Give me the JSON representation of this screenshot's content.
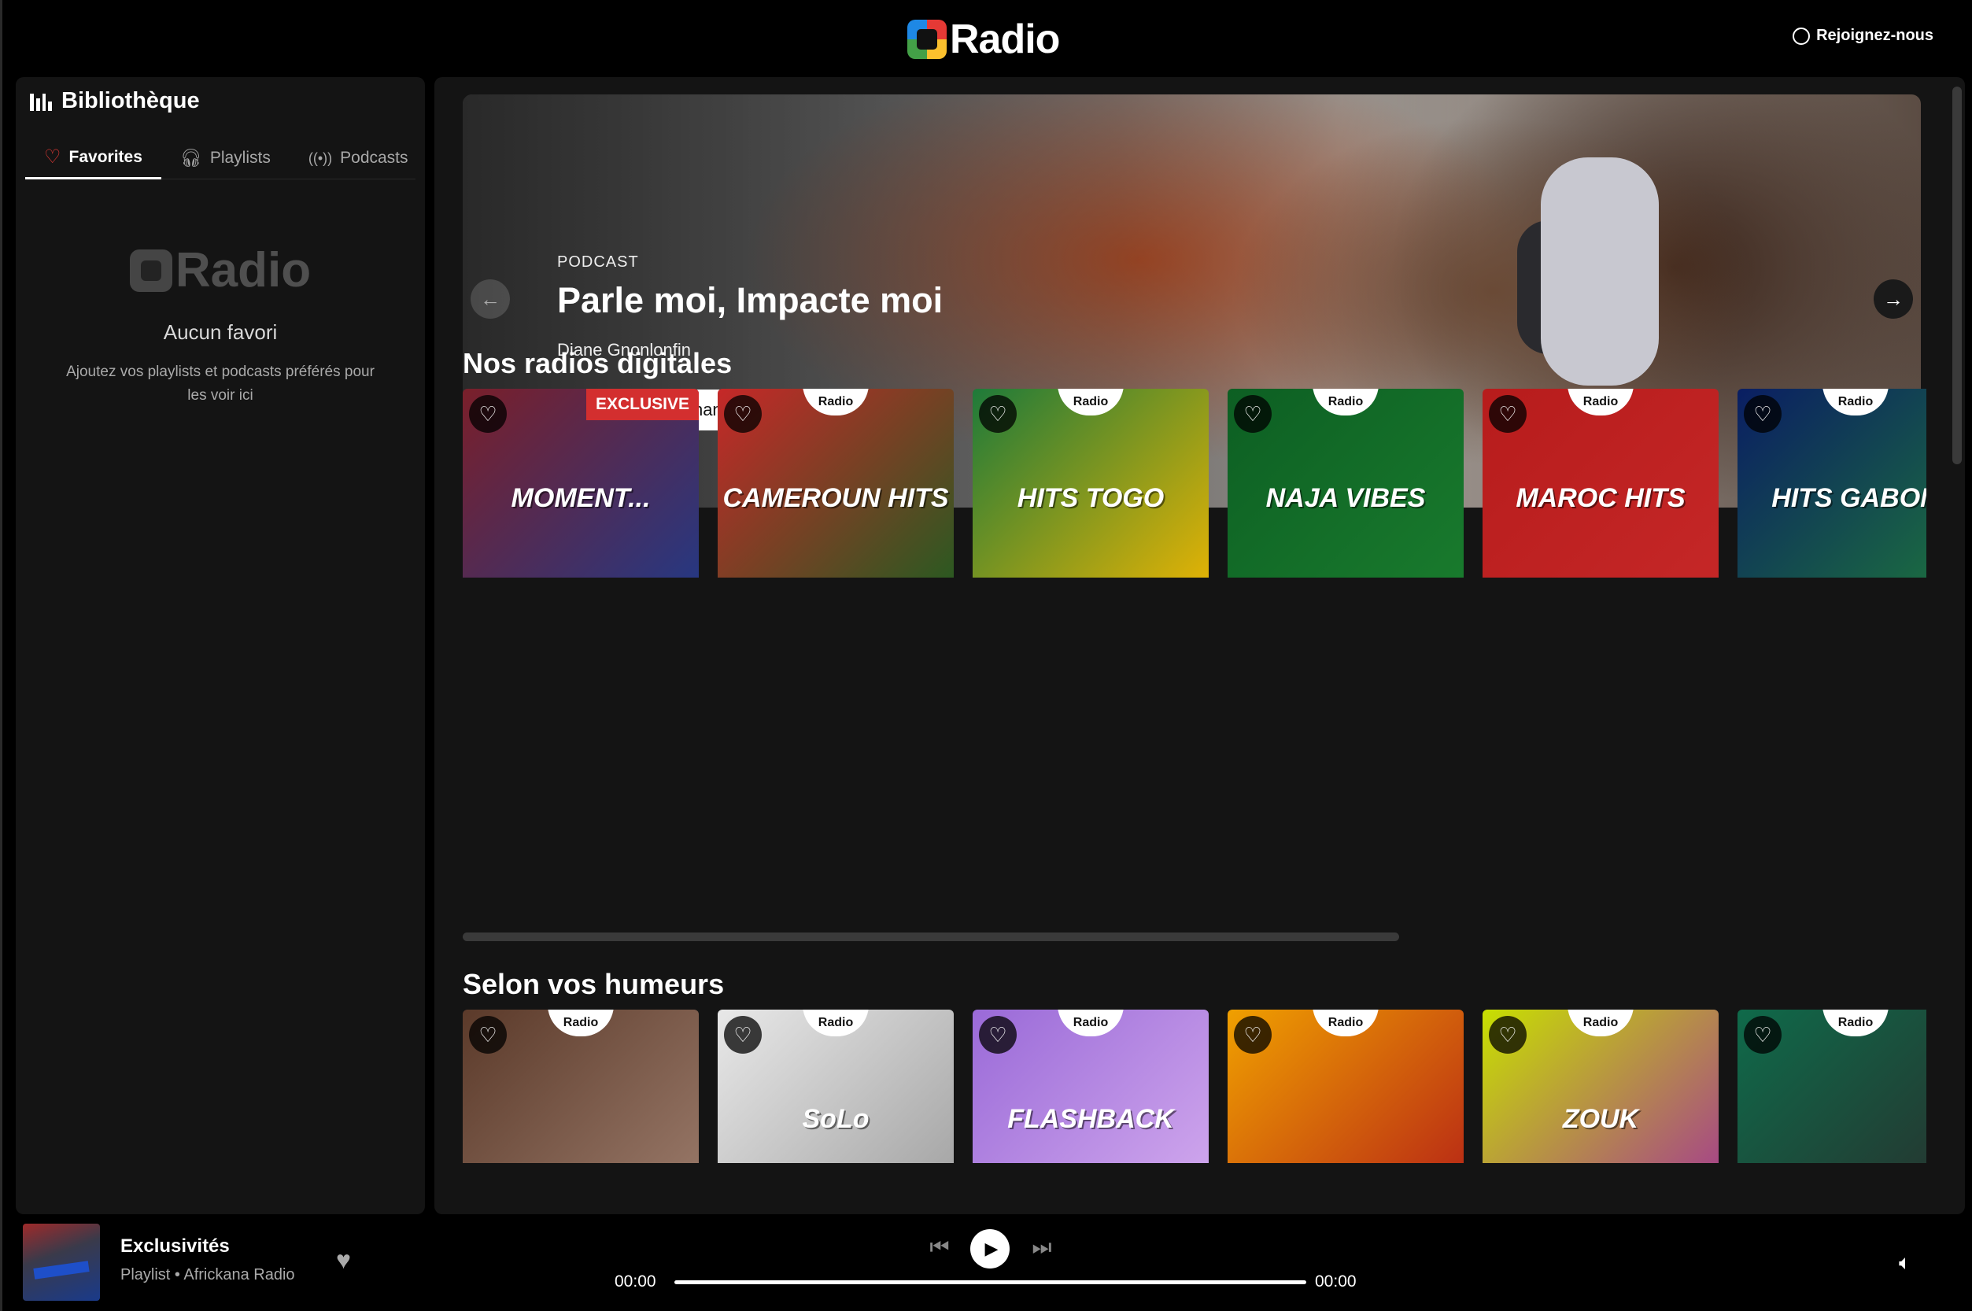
{
  "header": {
    "logo_text": "Radio",
    "join_label": "Rejoignez-nous"
  },
  "sidebar": {
    "title": "Bibliothèque",
    "tabs": [
      {
        "label": "Favorites",
        "icon": "heart-icon",
        "active": true
      },
      {
        "label": "Playlists",
        "icon": "headphones-icon",
        "active": false
      },
      {
        "label": "Podcasts",
        "icon": "broadcast-icon",
        "active": false
      }
    ],
    "empty": {
      "logo_text": "Radio",
      "title": "Aucun favori",
      "description": "Ajoutez vos playlists et podcasts préférés pour les voir ici"
    }
  },
  "hero": {
    "kicker": "PODCAST",
    "title": "Parle moi, Impacte moi",
    "author": "Diane Gnonlonfin",
    "cta_label": "Ecouter maintenant !"
  },
  "sections": {
    "digital": {
      "title": "Nos radios digitales",
      "items": [
        {
          "label": "Exclusivités",
          "badge": "EXCLUSIVE",
          "cover_text": "MOMENT...",
          "color_a": "#7a1f2a",
          "color_b": "#1e3a8a"
        },
        {
          "label": "Cameroun",
          "cover_text": "CAMEROUN HITS",
          "color_a": "#c62828",
          "color_b": "#1b5e20"
        },
        {
          "label": "Togo",
          "cover_text": "HITS TOGO",
          "color_a": "#1e7a3a",
          "color_b": "#f5b800"
        },
        {
          "label": "Naja",
          "cover_text": "NAJA VIBES",
          "color_a": "#0d5f23",
          "color_b": "#1a7d2e"
        },
        {
          "label": "Maroc",
          "cover_text": "MAROC HITS",
          "color_a": "#b71c1c",
          "color_b": "#c62828"
        },
        {
          "label": "Gabon",
          "cover_text": "HITS GABON",
          "color_a": "#0a1e63",
          "color_b": "#1e7a3a"
        }
      ],
      "logo_badge": "Radio"
    },
    "moods": {
      "title": "Selon vos humeurs",
      "items": [
        {
          "cover_text": "",
          "color_a": "#5b3a2a",
          "color_b": "#a08070"
        },
        {
          "cover_text": "SoLo",
          "color_a": "#e8e8e8",
          "color_b": "#9a9a9a"
        },
        {
          "cover_text": "FLASHBACK",
          "color_a": "#9a6ad8",
          "color_b": "#d8b0f0"
        },
        {
          "cover_text": "",
          "color_a": "#f0a000",
          "color_b": "#b01818"
        },
        {
          "cover_text": "ZOUK",
          "color_a": "#c8e000",
          "color_b": "#a02aa0"
        },
        {
          "cover_text": "",
          "color_a": "#0f6a4a",
          "color_b": "#2a2a2a"
        }
      ]
    }
  },
  "player": {
    "title": "Exclusivités",
    "subtitle": "Playlist • Africkana Radio",
    "time_current": "00:00",
    "time_total": "00:00"
  }
}
